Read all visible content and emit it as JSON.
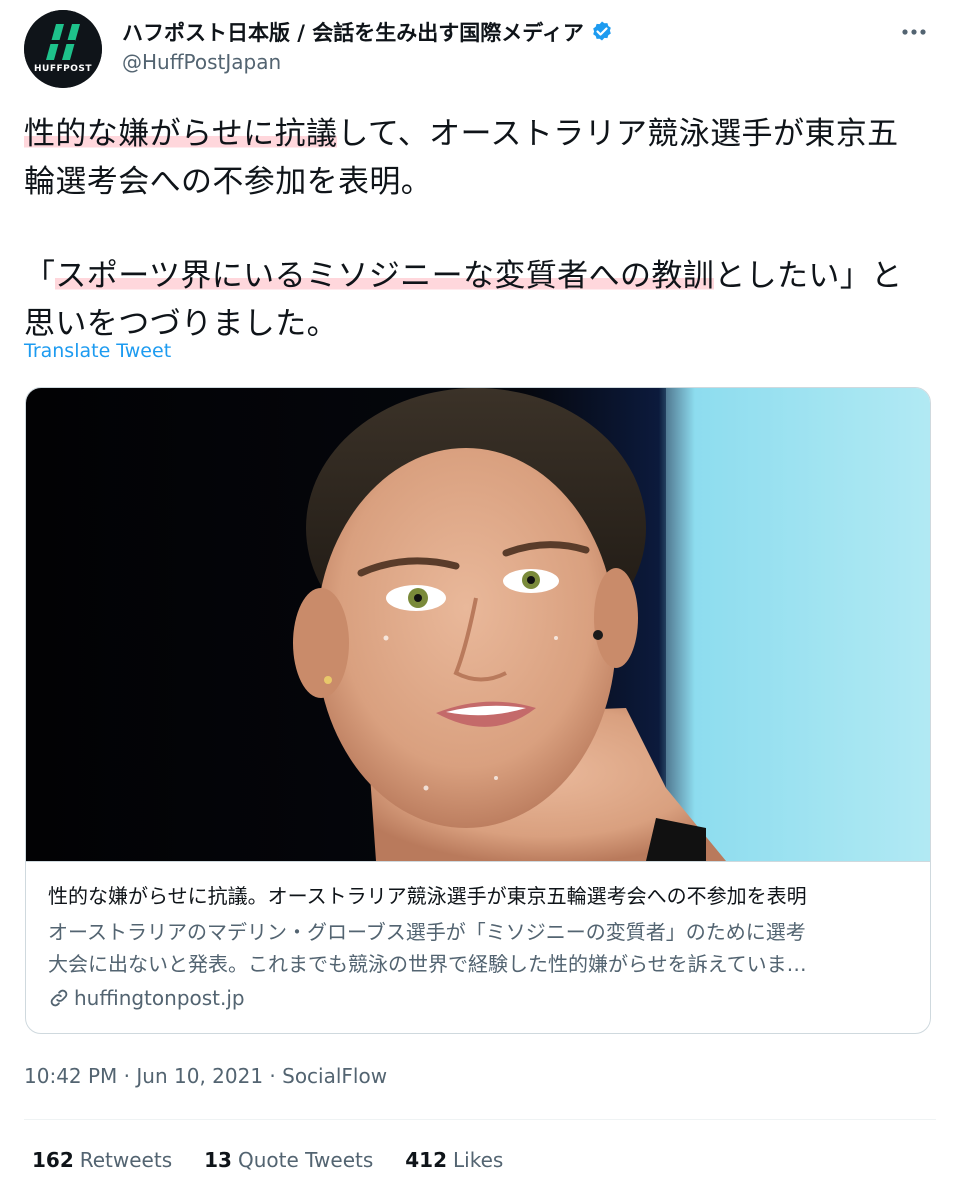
{
  "author": {
    "display_name": "ハフポスト日本版 / 会話を生み出す国際メディア",
    "handle": "@HuffPostJapan",
    "avatar_text": "HUFFPOST",
    "verified": true
  },
  "tweet": {
    "line1_hl": "性的な嫌がらせに抗議",
    "line1_rest": "して、オーストラリア競泳選手が東京五輪選考会への不参加を表明。",
    "line2_open": "「",
    "line2_hl": "スポーツ界にいるミソジニーな変質者への教訓",
    "line2_rest": "としたい」と思いをつづりました。"
  },
  "translate_label": "Translate Tweet",
  "card": {
    "title": "性的な嫌がらせに抗議。オーストラリア競泳選手が東京五輪選考会への不参加を表明",
    "desc_line1": "オーストラリアのマデリン・グローブス選手が「ミソジニーの変質者」のために選考",
    "desc_line2": "大会に出ないと発表。これまでも競泳の世界で経験した性的嫌がらせを訴えていま…",
    "domain": "huffingtonpost.jp"
  },
  "meta": {
    "timestamp": "10:42 PM · Jun 10, 2021 · SocialFlow"
  },
  "stats": {
    "retweets_count": "162",
    "retweets_label": "Retweets",
    "quotes_count": "13",
    "quotes_label": "Quote Tweets",
    "likes_count": "412",
    "likes_label": "Likes"
  },
  "colors": {
    "accent": "#1d9bf0",
    "secondary_text": "#536471",
    "highlight": "#ffd7dc",
    "border": "#cfd9de"
  },
  "icons": [
    "verified-badge-icon",
    "more-options-icon",
    "link-icon",
    "huffpost-logo"
  ]
}
